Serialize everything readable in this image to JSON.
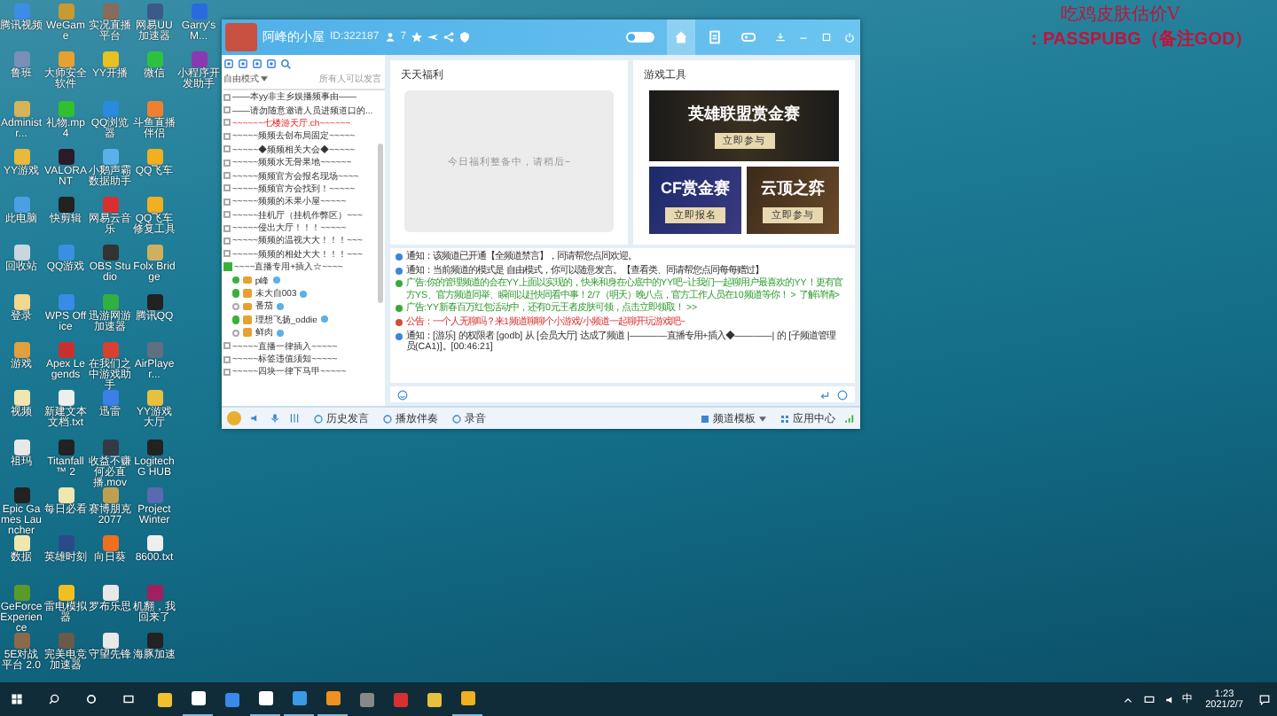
{
  "overlay": {
    "line_1": "吃鸡皮肤估价V",
    "line_2": "：PASSPUBG（备注GOD）"
  },
  "desktop": {
    "columns": [
      [
        {
          "label": "腾讯视频",
          "color": "#3a8ee8"
        },
        {
          "label": "鲁班",
          "color": "#7a8fb8"
        },
        {
          "label": "Administr...",
          "color": "#d6b45a"
        },
        {
          "label": "YY游戏",
          "color": "#e8b93a"
        },
        {
          "label": "此电脑",
          "color": "#4aa0e0"
        },
        {
          "label": "回收站",
          "color": "#c9d6e0"
        },
        {
          "label": "登录",
          "color": "#f0d890"
        },
        {
          "label": "游戏",
          "color": "#e0a040"
        },
        {
          "label": "视频",
          "color": "#f0e6b0"
        },
        {
          "label": "祖玛",
          "color": "#e8e8e8"
        },
        {
          "label": "Epic Games Launcher",
          "color": "#222222"
        },
        {
          "label": "数据",
          "color": "#f0e6b0"
        },
        {
          "label": "GeForce Experience",
          "color": "#5a9a2a"
        },
        {
          "label": "5E对战平台 2.0",
          "color": "#8a6a4a"
        }
      ],
      [
        {
          "label": "WeGame",
          "color": "#c89a30"
        },
        {
          "label": "大师安全软件",
          "color": "#e8a030"
        },
        {
          "label": "礼物.mp4",
          "color": "#30c030"
        },
        {
          "label": "VALORANT",
          "color": "#2a1a2a"
        },
        {
          "label": "快剪辑",
          "color": "#222222"
        },
        {
          "label": "QQ游戏",
          "color": "#3a90e0"
        },
        {
          "label": "WPS Office",
          "color": "#3a8ae8"
        },
        {
          "label": "Apex Legends",
          "color": "#c83030"
        },
        {
          "label": "新建文本文档.txt",
          "color": "#eeeeee"
        },
        {
          "label": "Titanfall™ 2",
          "color": "#222222"
        },
        {
          "label": "每日必看",
          "color": "#f0e6b0"
        },
        {
          "label": "英雄时刻",
          "color": "#2a4a8a"
        },
        {
          "label": "雷电模拟器",
          "color": "#f0c020"
        },
        {
          "label": "完美电竞加速器",
          "color": "#6a5a4a"
        }
      ],
      [
        {
          "label": "实况直播平台",
          "color": "#8a6a5a"
        },
        {
          "label": "YY开播",
          "color": "#e8c020"
        },
        {
          "label": "QQ浏览器",
          "color": "#2a8ae0"
        },
        {
          "label": "小鹅声霸数据助手",
          "color": "#5ab0e8"
        },
        {
          "label": "网易云音乐",
          "color": "#d83030"
        },
        {
          "label": "OBS Studio",
          "color": "#333333"
        },
        {
          "label": "迅游网游加速器",
          "color": "#30b040"
        },
        {
          "label": "在我们之中游戏助手",
          "color": "#d84030"
        },
        {
          "label": "迅雷",
          "color": "#3a80e8"
        },
        {
          "label": "收益不赚何必直播.mov",
          "color": "#333a44"
        },
        {
          "label": "赛博朋克 2077",
          "color": "#c0a050"
        },
        {
          "label": "向日葵",
          "color": "#f07020"
        },
        {
          "label": "罗布乐思",
          "color": "#e8e8e8"
        },
        {
          "label": "守望先锋",
          "color": "#e8e8e8"
        }
      ],
      [
        {
          "label": "网易UU加速器",
          "color": "#3a5a8a"
        },
        {
          "label": "微信",
          "color": "#30c040"
        },
        {
          "label": "斗鱼直播伴侣",
          "color": "#f08030"
        },
        {
          "label": "QQ飞车",
          "color": "#f0b020"
        },
        {
          "label": "QQ飞车修复工具",
          "color": "#f0b020"
        },
        {
          "label": "Folx Bridge",
          "color": "#d0b060"
        },
        {
          "label": "腾讯QQ",
          "color": "#222222"
        },
        {
          "label": "AirPlayer...",
          "color": "#607080"
        },
        {
          "label": "YY游戏大厅",
          "color": "#e8c040"
        },
        {
          "label": "Logitech G HUB",
          "color": "#222222"
        },
        {
          "label": "Project Winter",
          "color": "#5a6ab0"
        },
        {
          "label": "8600.txt",
          "color": "#eeeeee"
        },
        {
          "label": "机翻，我回来了",
          "color": "#a02060"
        },
        {
          "label": "海豚加速",
          "color": "#222222"
        }
      ],
      [
        {
          "label": "Garry's M...",
          "color": "#2a6ae0"
        },
        {
          "label": "小程序开发助手",
          "color": "#8a3ab0"
        }
      ]
    ]
  },
  "window": {
    "title": "阿峰的小屋",
    "id": "ID:322187",
    "members": "7",
    "toggle_on": false,
    "tabs": [
      {
        "kind": "home",
        "selected": true
      },
      {
        "kind": "document",
        "selected": false
      },
      {
        "kind": "game",
        "selected": false
      }
    ]
  },
  "sidebar": {
    "mode": "自由模式",
    "mode_hint": "所有人可以发言",
    "channels": [
      {
        "kind": "channel",
        "label": "——本yy非主乡娱播频事由——"
      },
      {
        "kind": "channel",
        "label": "——请勿随意邀请人员进频道口的..."
      },
      {
        "kind": "hot",
        "label": "~~~~~~七楼游天厅.ch~~~~~~"
      },
      {
        "kind": "channel",
        "label": "~~~~~频频去创布局固定~~~~~"
      },
      {
        "kind": "channel",
        "label": "~~~~~◆频频相关大会◆~~~~~"
      },
      {
        "kind": "channel",
        "label": "~~~~~频频水无骨果地~~~~~~"
      },
      {
        "kind": "channel",
        "label": "~~~~~频频官方会报名现场~~~~"
      },
      {
        "kind": "channel",
        "label": "~~~~~频频官方会找到！~~~~~"
      },
      {
        "kind": "channel",
        "label": "~~~~~频频的禾果小屋~~~~~"
      },
      {
        "kind": "channel",
        "label": "~~~~~挂机厅（挂机作弊区）~~~"
      },
      {
        "kind": "channel",
        "label": "~~~~~侵出大厅！！！~~~~~"
      },
      {
        "kind": "channel",
        "label": "~~~~~频频的温视大大！！！~~~"
      },
      {
        "kind": "channel",
        "label": "~~~~~频频的相处大大！！！~~~"
      },
      {
        "kind": "live",
        "label": "~~~~直播专用+插入☆~~~~",
        "expanded": true,
        "children": [
          {
            "name": "p峰",
            "online": true
          },
          {
            "name": "未大自003",
            "online": true
          },
          {
            "name": "番茄",
            "online": false
          },
          {
            "name": "理想飞扬_oddie",
            "online": true
          },
          {
            "name": "鲜肉",
            "online": false
          }
        ]
      },
      {
        "kind": "channel",
        "label": "~~~~~直播一律插入~~~~~"
      },
      {
        "kind": "channel",
        "label": "~~~~~标签违值须知~~~~~"
      },
      {
        "kind": "channel",
        "label": "~~~~~四块一律下马甲~~~~~"
      }
    ]
  },
  "welfare": {
    "title": "天天福利",
    "empty_message": "今日福利整备中，请稍后~"
  },
  "tools": {
    "title": "游戏工具",
    "banners": [
      {
        "title": "英雄联盟赏金赛",
        "button": "立即参与"
      },
      {
        "title": "CF赏金赛",
        "button": "立即报名"
      },
      {
        "title": "云顶之弈",
        "button": "立即参与"
      }
    ]
  },
  "chat": {
    "messages": [
      {
        "kind": "notice",
        "text": "通知：该频道已开通【全频道禁言】，同请帮您点同欢迎。"
      },
      {
        "kind": "notice",
        "text": "通知：当前频道的模式是 自由模式，你可以随意发言。【查看类、同请帮您点同每每赠过】"
      },
      {
        "kind": "ad",
        "text": "广告:你的管理频道的会在YY上面以实现的，快来和身在心底中的YY吧~让我们一起聊用户最喜欢的YY！更有官方YS、官方频道同举、瞬间以赶快同看中事！2/7（明天）晚八点，官方工作人员在10频道等你！ > 了解详情>"
      },
      {
        "kind": "ad",
        "text": "广告:YY新春百万红包活动中，还有0元王者皮肤可领，点击立即领取！ >>"
      },
      {
        "kind": "announcement",
        "text": "公告：一个人无聊吗？来1频道聊聊个小游戏/小频道一起聊开玩游戏吧~"
      },
      {
        "kind": "notice",
        "text": "通知：[游乐] 的权限者 [godb] 从 [会员大厅] 达成了频道 |————直播专用+插入◆————| 的 [子频道管理员(CA1)]。[00:46:21]"
      }
    ]
  },
  "toolbar": {
    "items": [
      "历史发言",
      "播放伴奏",
      "录音"
    ],
    "template": "频道模板",
    "app_center": "应用中心"
  },
  "taskbar": {
    "apps": [
      {
        "color": "#f0c030",
        "running": false
      },
      {
        "color": "#ffffff",
        "running": true
      },
      {
        "color": "#3a8ae8",
        "running": false
      },
      {
        "color": "#ffffff",
        "running": true
      },
      {
        "color": "#3a9ae8",
        "running": true
      },
      {
        "color": "#f09020",
        "running": true
      },
      {
        "color": "#888888",
        "running": false
      },
      {
        "color": "#d83030",
        "running": false
      },
      {
        "color": "#e8c040",
        "running": false
      },
      {
        "color": "#f0b020",
        "running": true
      }
    ],
    "ime": "中",
    "time": "1:23",
    "date": "2021/2/7"
  }
}
